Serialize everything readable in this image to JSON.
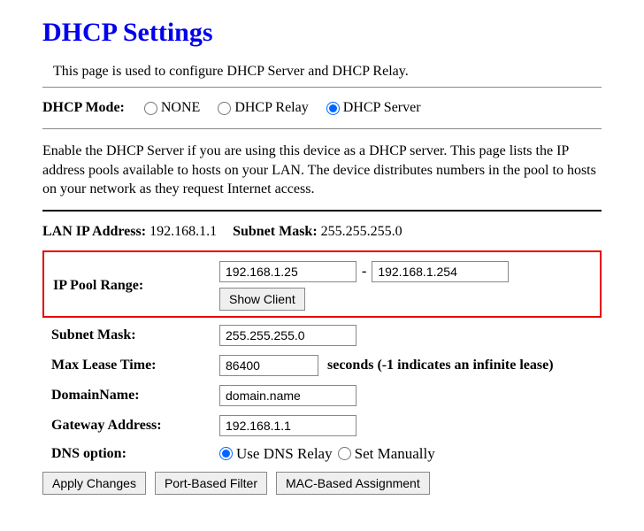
{
  "title": "DHCP Settings",
  "intro": "This page is used to configure DHCP Server and DHCP Relay.",
  "mode": {
    "label": "DHCP Mode:",
    "options": {
      "none": "NONE",
      "relay": "DHCP Relay",
      "server": "DHCP Server"
    },
    "selected": "server"
  },
  "desc": "Enable the DHCP Server if you are using this device as a DHCP server. This page lists the IP address pools available to hosts on your LAN. The device distributes numbers in the pool to hosts on your network as they request Internet access.",
  "lan": {
    "ip_label": "LAN IP Address:",
    "ip": "192.168.1.1",
    "mask_label": "Subnet Mask:",
    "mask": "255.255.255.0"
  },
  "pool": {
    "label": "IP Pool Range:",
    "start": "192.168.1.25",
    "end": "192.168.1.254",
    "show_client": "Show Client"
  },
  "subnet": {
    "label": "Subnet Mask:",
    "value": "255.255.255.0"
  },
  "lease": {
    "label": "Max Lease Time:",
    "value": "86400",
    "suffix": "seconds (-1 indicates an infinite lease)"
  },
  "domain": {
    "label": "DomainName:",
    "value": "domain.name"
  },
  "gateway": {
    "label": "Gateway Address:",
    "value": "192.168.1.1"
  },
  "dns": {
    "label": "DNS option:",
    "relay": "Use DNS Relay",
    "manual": "Set Manually",
    "selected": "relay"
  },
  "buttons": {
    "apply": "Apply Changes",
    "port_filter": "Port-Based Filter",
    "mac_assign": "MAC-Based Assignment"
  }
}
